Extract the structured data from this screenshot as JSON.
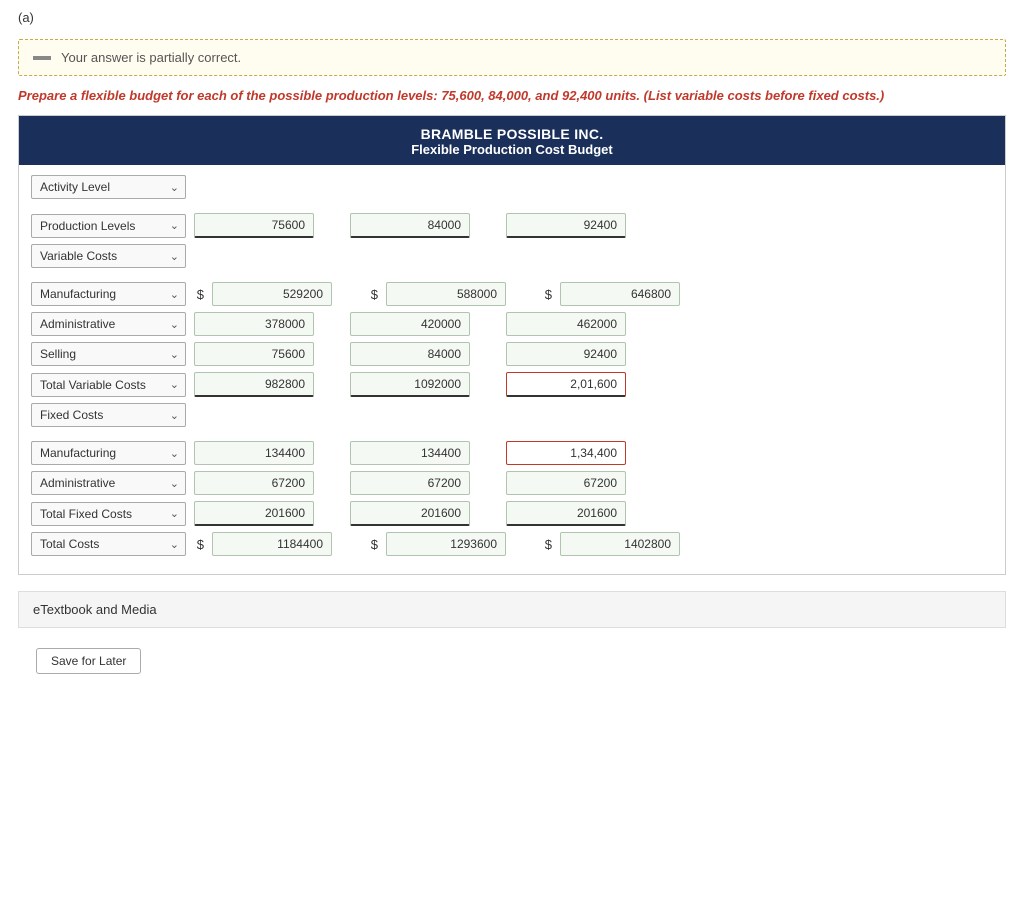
{
  "page": {
    "section_label": "(a)",
    "alert": {
      "text": "Your answer is partially correct."
    },
    "instruction": {
      "base": "Prepare a flexible budget for each of the possible production levels: 75,600, 84,000, and 92,400 units.",
      "note": "(List variable costs before fixed costs.)"
    },
    "table": {
      "title": "BRAMBLE POSSIBLE INC.",
      "subtitle": "Flexible Production Cost Budget",
      "rows": [
        {
          "id": "activity-level",
          "label": "Activity Level",
          "cols": [
            null,
            null,
            null
          ],
          "dollar": [
            false,
            false,
            false
          ],
          "error": [
            false,
            false,
            false
          ],
          "underline": false
        },
        {
          "id": "production-levels",
          "label": "Production Levels",
          "cols": [
            "75600",
            "84000",
            "92400"
          ],
          "dollar": [
            false,
            false,
            false
          ],
          "error": [
            false,
            false,
            false
          ],
          "underline": true
        },
        {
          "id": "variable-costs",
          "label": "Variable Costs",
          "cols": [
            null,
            null,
            null
          ],
          "dollar": [
            false,
            false,
            false
          ],
          "error": [
            false,
            false,
            false
          ],
          "underline": false
        },
        {
          "id": "manufacturing-var",
          "label": "Manufacturing",
          "cols": [
            "529200",
            "588000",
            "646800"
          ],
          "dollar": [
            true,
            true,
            true
          ],
          "error": [
            false,
            false,
            false
          ],
          "underline": false
        },
        {
          "id": "administrative-var",
          "label": "Administrative",
          "cols": [
            "378000",
            "420000",
            "462000"
          ],
          "dollar": [
            false,
            false,
            false
          ],
          "error": [
            false,
            false,
            false
          ],
          "underline": false
        },
        {
          "id": "selling-var",
          "label": "Selling",
          "cols": [
            "75600",
            "84000",
            "92400"
          ],
          "dollar": [
            false,
            false,
            false
          ],
          "error": [
            false,
            false,
            false
          ],
          "underline": false
        },
        {
          "id": "total-variable-costs",
          "label": "Total Variable Costs",
          "cols": [
            "982800",
            "1092000",
            "2,01,600"
          ],
          "dollar": [
            false,
            false,
            false
          ],
          "error": [
            false,
            false,
            true
          ],
          "underline": true
        },
        {
          "id": "fixed-costs",
          "label": "Fixed Costs",
          "cols": [
            null,
            null,
            null
          ],
          "dollar": [
            false,
            false,
            false
          ],
          "error": [
            false,
            false,
            false
          ],
          "underline": false
        },
        {
          "id": "manufacturing-fix",
          "label": "Manufacturing",
          "cols": [
            "134400",
            "134400",
            "1,34,400"
          ],
          "dollar": [
            false,
            false,
            false
          ],
          "error": [
            false,
            false,
            true
          ],
          "underline": false
        },
        {
          "id": "administrative-fix",
          "label": "Administrative",
          "cols": [
            "67200",
            "67200",
            "67200"
          ],
          "dollar": [
            false,
            false,
            false
          ],
          "error": [
            false,
            false,
            false
          ],
          "underline": false
        },
        {
          "id": "total-fixed-costs",
          "label": "Total Fixed Costs",
          "cols": [
            "201600",
            "201600",
            "201600"
          ],
          "dollar": [
            false,
            false,
            false
          ],
          "error": [
            false,
            false,
            false
          ],
          "underline": true
        },
        {
          "id": "total-costs",
          "label": "Total Costs",
          "cols": [
            "1184400",
            "1293600",
            "1402800"
          ],
          "dollar": [
            true,
            true,
            true
          ],
          "error": [
            false,
            false,
            false
          ],
          "underline": false
        }
      ]
    },
    "bottom_section_label": "eTextbook and Media",
    "save_button": "Save for Later"
  }
}
